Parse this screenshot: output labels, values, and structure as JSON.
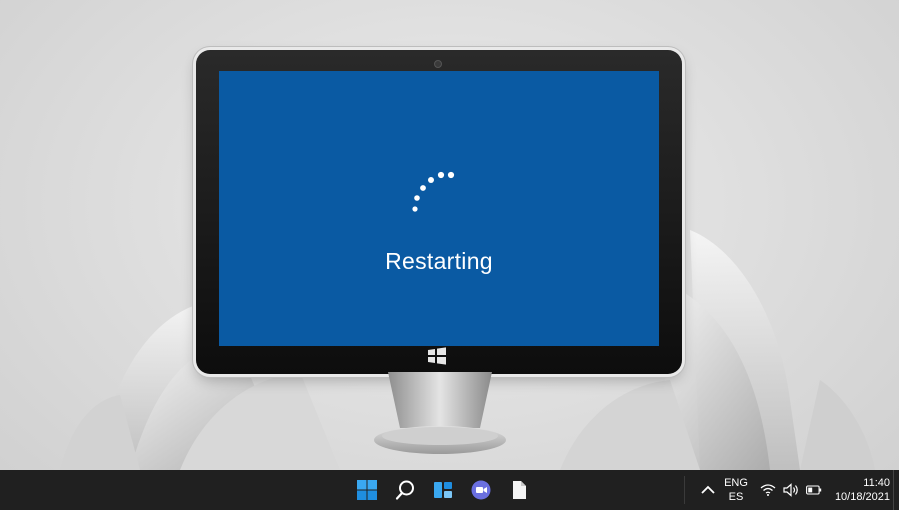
{
  "screen": {
    "status_text": "Restarting",
    "background_color": "#0a5aa3"
  },
  "taskbar": {
    "icons": [
      "start-icon",
      "search-icon",
      "widgets-icon",
      "chat-icon",
      "file-icon"
    ],
    "tray": {
      "language": "ENG",
      "layout": "ES",
      "time": "11:40",
      "date": "10/18/2021",
      "icons": [
        "chevron-up-icon",
        "wifi-icon",
        "volume-icon",
        "battery-icon"
      ]
    }
  }
}
